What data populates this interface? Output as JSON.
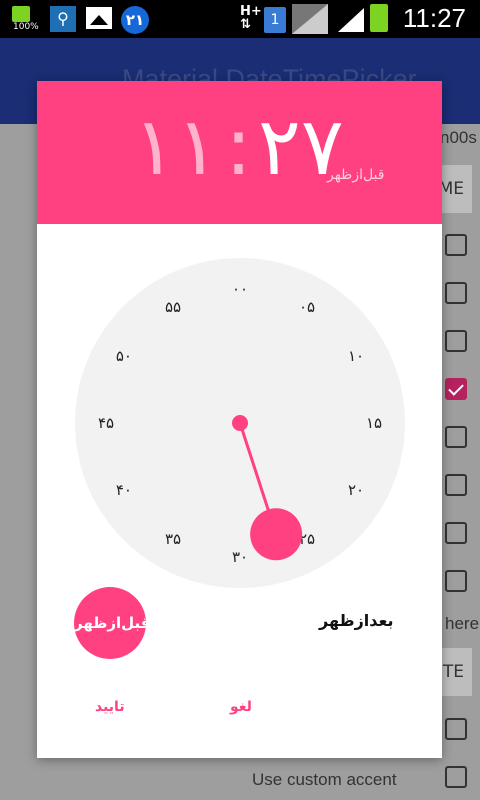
{
  "status_bar": {
    "battery_percent": "100%",
    "notification_badge": "۲۱",
    "network_type": "H+",
    "sim_slot": "1",
    "time": "11:27"
  },
  "background": {
    "app_title": "Material DateTimePicker",
    "partial_text_right": "n00s",
    "time_button_label": "ME",
    "date_button_label": "TE",
    "partial_text_here": "here.",
    "custom_accent_label": "Use custom accent",
    "checkbox_states": [
      false,
      false,
      false,
      true,
      false,
      false,
      false,
      false,
      false,
      false
    ]
  },
  "dialog": {
    "accent_color": "#ff4081",
    "header": {
      "hour": "۱۱",
      "separator": ":",
      "minute": "۲۷",
      "ampm": "قبل‌ازظهر"
    },
    "clock": {
      "numbers": [
        "۰۰",
        "۰۵",
        "۱۰",
        "۱۵",
        "۲۰",
        "۲۵",
        "۳۰",
        "۳۵",
        "۴۰",
        "۴۵",
        "۵۰",
        "۵۵"
      ],
      "selected_minute": 27
    },
    "am_label": "قبل‌ازظهر",
    "pm_label": "بعدازظهر",
    "selected_period": "am",
    "ok_button": "تایید",
    "cancel_button": "لغو"
  }
}
